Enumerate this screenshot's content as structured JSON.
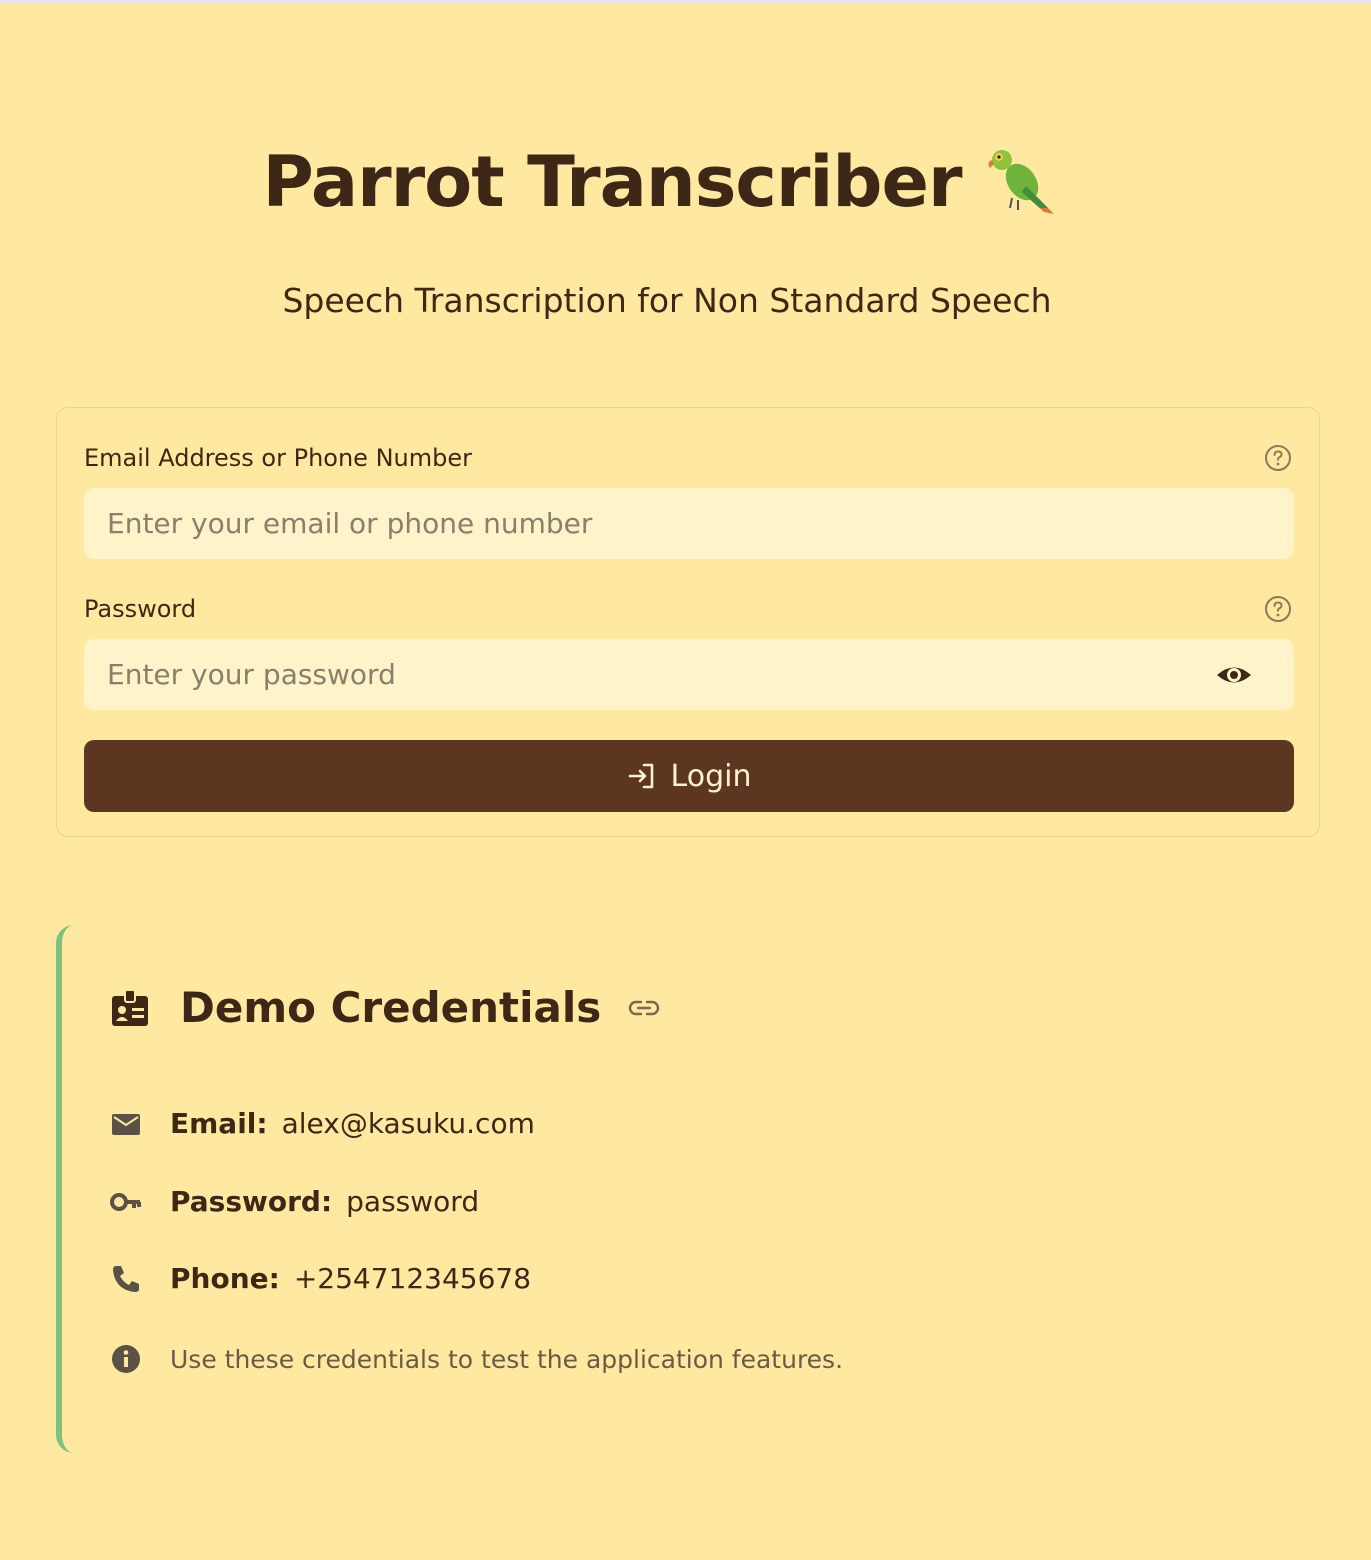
{
  "header": {
    "title": "Parrot Transcriber",
    "title_emoji_icon": "parrot-icon",
    "subtitle": "Speech Transcription for Non Standard Speech"
  },
  "login_form": {
    "identifier": {
      "label": "Email Address or Phone Number",
      "placeholder": "Enter your email or phone number",
      "value": "",
      "help_icon": "help-circle-icon"
    },
    "password": {
      "label": "Password",
      "placeholder": "Enter your password",
      "value": "",
      "help_icon": "help-circle-icon",
      "toggle_icon": "eye-icon"
    },
    "submit": {
      "label": "Login",
      "icon": "login-arrow-icon"
    }
  },
  "demo": {
    "title": "Demo Credentials",
    "title_icon": "badge-icon",
    "link_icon": "link-icon",
    "rows": [
      {
        "icon": "mail-icon",
        "key": "Email:",
        "value": "alex@kasuku.com"
      },
      {
        "icon": "key-icon",
        "key": "Password:",
        "value": "password"
      },
      {
        "icon": "phone-icon",
        "key": "Phone:",
        "value": "+254712345678"
      }
    ],
    "note": "Use these credentials to test the application features.",
    "note_icon": "info-icon"
  },
  "colors": {
    "background": "#ffe9a0",
    "input_background": "#fff4c9",
    "primary_button": "#5c3620",
    "text": "#3d2817",
    "accent_border": "#7ec281"
  }
}
